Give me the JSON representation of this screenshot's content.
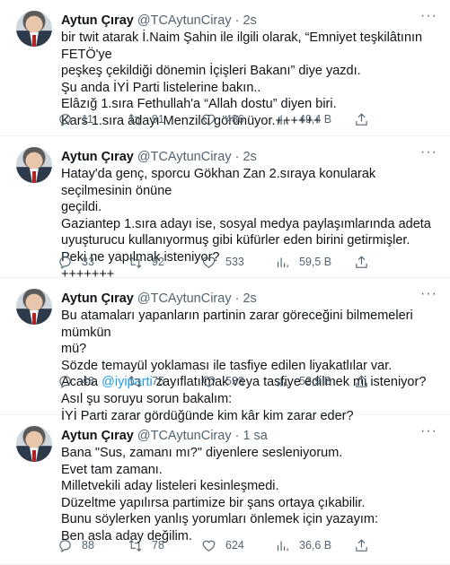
{
  "tweets": [
    {
      "name": "Aytun Çıray",
      "handle": "@TCAytunCiray",
      "time": "2s",
      "lines": [
        "bir twit atarak İ.Naim Şahin ile ilgili olarak, “Emniyet teşkilâtının FETÖ'ye",
        "peşkeş çekildiği dönemin İçişleri Bakanı” diye yazdı.",
        "Şu anda İYİ Parti listelerine bakın..",
        "Elâzığ 1.sıra Fethullah'a “Allah dostu” diyen biri.",
        "Kars 1.sıra adayı Menzilci görünüyor.++++++"
      ],
      "replies": "11",
      "retweets": "91",
      "likes": "486",
      "views": "49,4 B"
    },
    {
      "name": "Aytun Çıray",
      "handle": "@TCAytunCiray",
      "time": "2s",
      "lines": [
        "Hatay'da genç, sporcu Gökhan Zan 2.sıraya konularak seçilmesinin önüne",
        "geçildi.",
        "Gaziantep 1.sıra adayı ise, sosyal medya paylaşımlarında adeta",
        "uyuşturucu kullanıyormuş gibi küfürler eden birini getirmişler.",
        "Peki ne yapılmak isteniyor?",
        "+++++++"
      ],
      "replies": "33",
      "retweets": "92",
      "likes": "533",
      "views": "59,5 B"
    },
    {
      "name": "Aytun Çıray",
      "handle": "@TCAytunCiray",
      "time": "2s",
      "lines": [
        "Bu atamaları yapanların partinin zarar göreceğini bilmemeleri mümkün",
        "mü?",
        "Sözde temayül yoklaması ile tasfiye edilen liyakatlılar var.",
        "Acaba ",
        "Asıl şu soruyu sorun bakalım:",
        "İYİ Parti zarar gördüğünde kim kâr kim zarar eder?"
      ],
      "mention": "@iyiparti",
      "mention_tail": " zayıflatılmak veya tasfiye edilmek mi isteniyor?",
      "replies": "48",
      "retweets": "75",
      "likes": "533",
      "views": "53,9 B"
    },
    {
      "name": "Aytun Çıray",
      "handle": "@TCAytunCiray",
      "time": "1 sa",
      "lines": [
        "Bana \"Sus, zamanı mı?\" diyenlere sesleniyorum.",
        "Evet tam zamanı.",
        "Milletvekili aday listeleri kesinleşmedi.",
        "Düzeltme yapılırsa partimize bir şans ortaya çıkabilir.",
        "Bunu söylerken yanlış yorumları önlemek için yazayım:",
        "Ben asla aday değilim."
      ],
      "replies": "88",
      "retweets": "78",
      "likes": "624",
      "views": "36,6 B"
    }
  ],
  "icons": {
    "reply": "reply-icon",
    "retweet": "retweet-icon",
    "like": "heart-icon",
    "views": "views-chart-icon",
    "share": "share-icon",
    "more": "more-options-icon"
  }
}
